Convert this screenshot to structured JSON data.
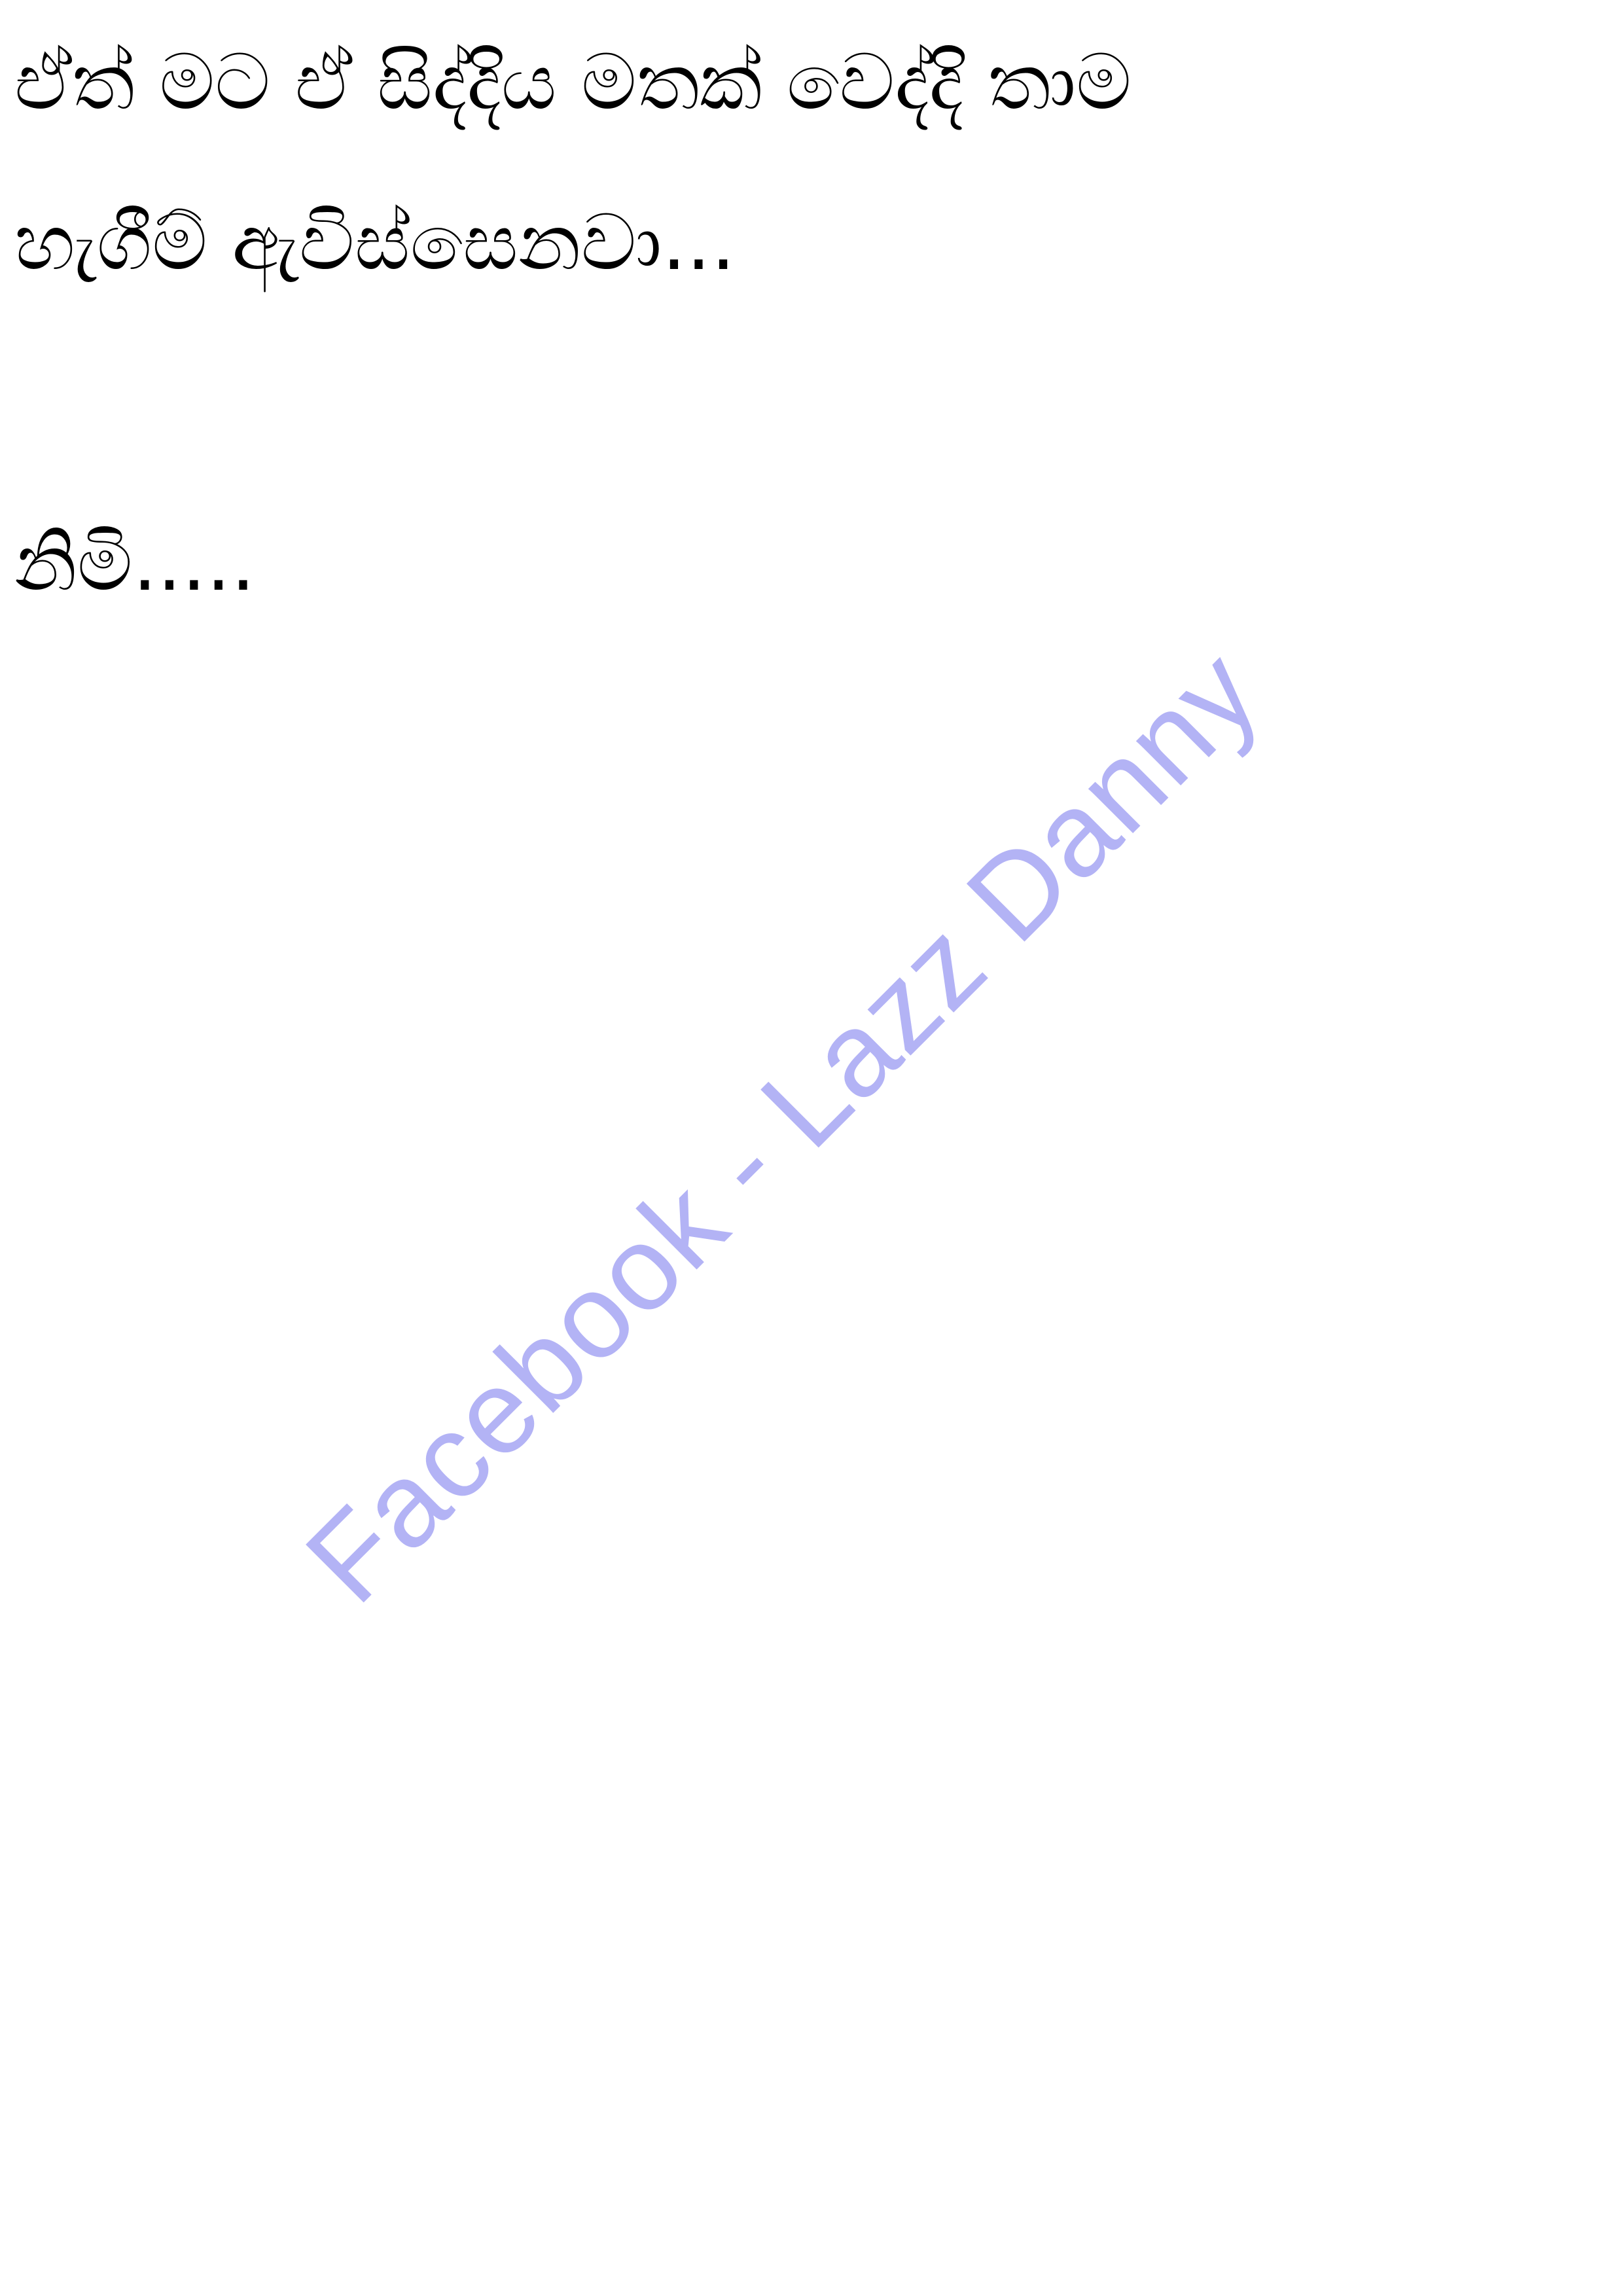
{
  "document": {
    "lines": [
      "ඒත් මට ඒ සිද්දිය මතක් වෙද්දි තාම",
      "හැගීම් ඇවිස්සෙනවා...",
      "නිමි....."
    ],
    "watermark": "Facebook - Lazz Danny"
  },
  "colors": {
    "text": "#000000",
    "watermark": "#b3b3f5",
    "background": "#ffffff"
  }
}
